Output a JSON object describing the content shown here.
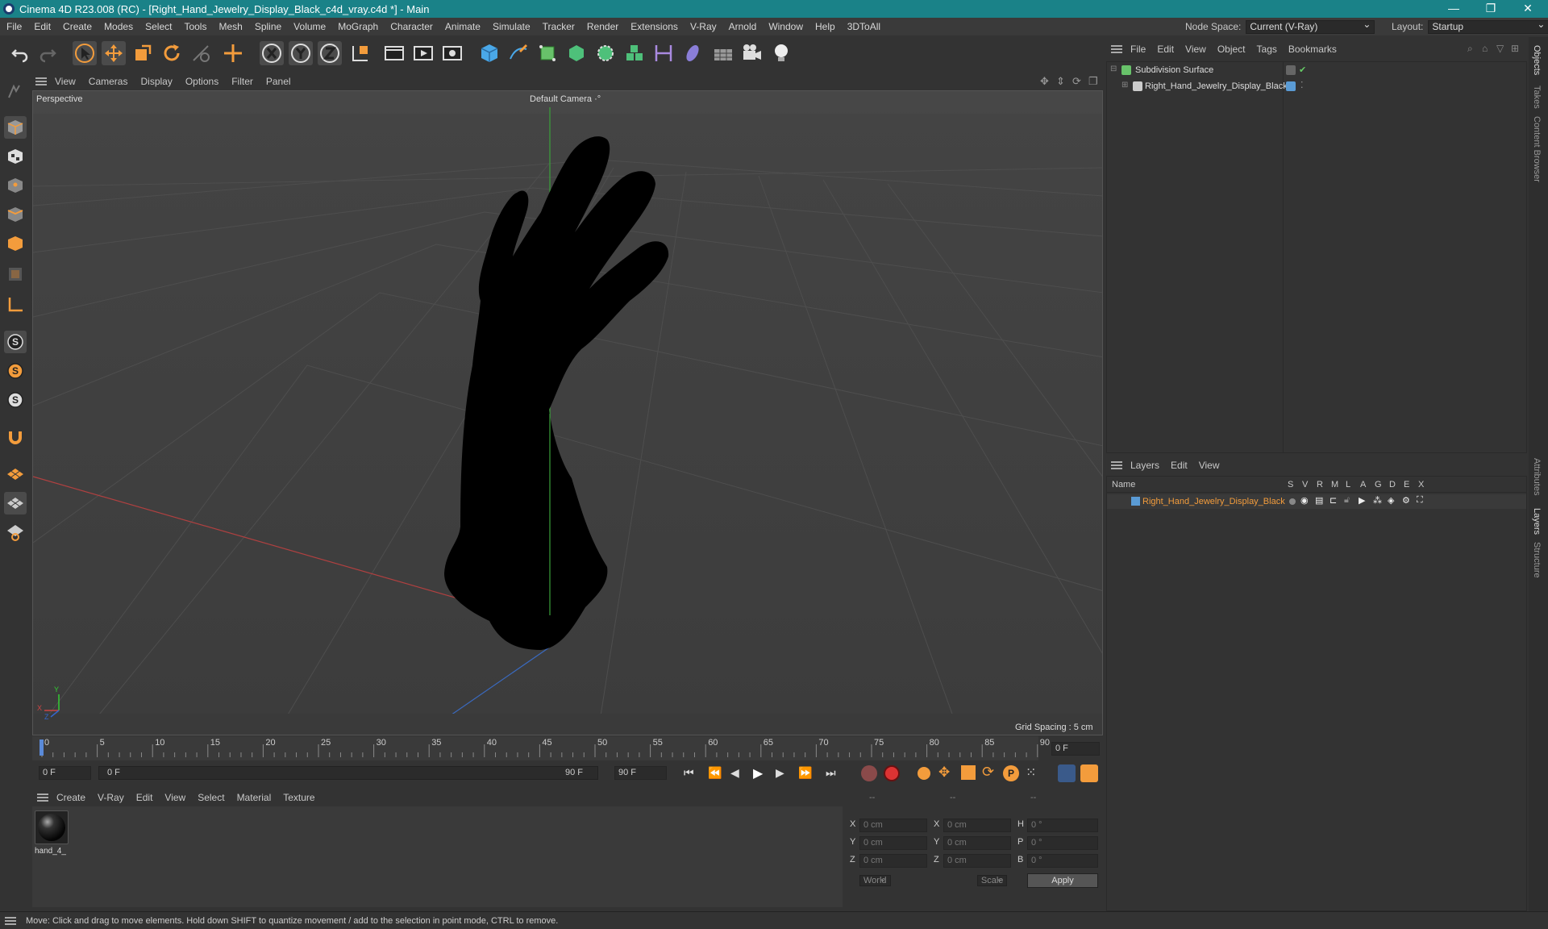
{
  "window": {
    "title": "Cinema 4D R23.008 (RC) - [Right_Hand_Jewelry_Display_Black_c4d_vray.c4d *] - Main",
    "controls": {
      "minimize": "—",
      "restore": "❐",
      "close": "✕"
    }
  },
  "menubar": {
    "items": [
      "File",
      "Edit",
      "Create",
      "Modes",
      "Select",
      "Tools",
      "Mesh",
      "Spline",
      "Volume",
      "MoGraph",
      "Character",
      "Animate",
      "Simulate",
      "Tracker",
      "Render",
      "Extensions",
      "V-Ray",
      "Arnold",
      "Window",
      "Help",
      "3DToAll"
    ],
    "node_space_label": "Node Space:",
    "node_space_value": "Current (V-Ray)",
    "layout_label": "Layout:",
    "layout_value": "Startup"
  },
  "viewport": {
    "menu": [
      "View",
      "Cameras",
      "Display",
      "Options",
      "Filter",
      "Panel"
    ],
    "view_name": "Perspective",
    "camera_label": "Default Camera",
    "camera_glyph": "·°",
    "grid_spacing": "Grid Spacing : 5 cm",
    "axis": {
      "x": "X",
      "y": "Y",
      "z": "Z"
    }
  },
  "timeline": {
    "ticks": [
      "0",
      "5",
      "10",
      "15",
      "20",
      "25",
      "30",
      "35",
      "40",
      "45",
      "50",
      "55",
      "60",
      "65",
      "70",
      "75",
      "80",
      "85",
      "90"
    ],
    "frame_field": "0 F",
    "start_field": "0 F",
    "range_start": "0 F",
    "range_end": "90 F",
    "end_field": "90 F"
  },
  "material_manager": {
    "menu": [
      "Create",
      "V-Ray",
      "Edit",
      "View",
      "Select",
      "Material",
      "Texture"
    ],
    "materials": [
      {
        "name": "hand_4_"
      }
    ]
  },
  "coordinates": {
    "header": [
      "--",
      "--",
      "--"
    ],
    "rows": [
      {
        "l1": "X",
        "v1": "0 cm",
        "l2": "X",
        "v2": "0 cm",
        "l3": "H",
        "v3": "0 °"
      },
      {
        "l1": "Y",
        "v1": "0 cm",
        "l2": "Y",
        "v2": "0 cm",
        "l3": "P",
        "v3": "0 °"
      },
      {
        "l1": "Z",
        "v1": "0 cm",
        "l2": "Z",
        "v2": "0 cm",
        "l3": "B",
        "v3": "0 °"
      }
    ],
    "mode": "World",
    "size_mode": "Scale",
    "apply": "Apply"
  },
  "object_manager": {
    "menu": [
      "File",
      "Edit",
      "View",
      "Object",
      "Tags",
      "Bookmarks"
    ],
    "objects": [
      {
        "name": "Subdivision Surface",
        "color": "#68c26a"
      },
      {
        "name": "Right_Hand_Jewelry_Display_Black",
        "color": "#5a9bd5"
      }
    ]
  },
  "layer_manager": {
    "menu": [
      "Layers",
      "Edit",
      "View"
    ],
    "columns": [
      "Name",
      "S",
      "V",
      "R",
      "M",
      "L",
      "A",
      "G",
      "D",
      "E",
      "X"
    ],
    "layers": [
      {
        "name": "Right_Hand_Jewelry_Display_Black",
        "color": "#5a9bd5"
      }
    ]
  },
  "side_tabs": [
    "Objects",
    "Takes",
    "Content Browser",
    "Attributes",
    "Layers",
    "Structure"
  ],
  "status": "Move: Click and drag to move elements. Hold down SHIFT to quantize movement / add to the selection in point mode, CTRL to remove.",
  "colors": {
    "accent": "#1a8288",
    "highlight": "#f39c3c",
    "axis_x": "#c44",
    "axis_y": "#3c3",
    "axis_z": "#36c"
  }
}
